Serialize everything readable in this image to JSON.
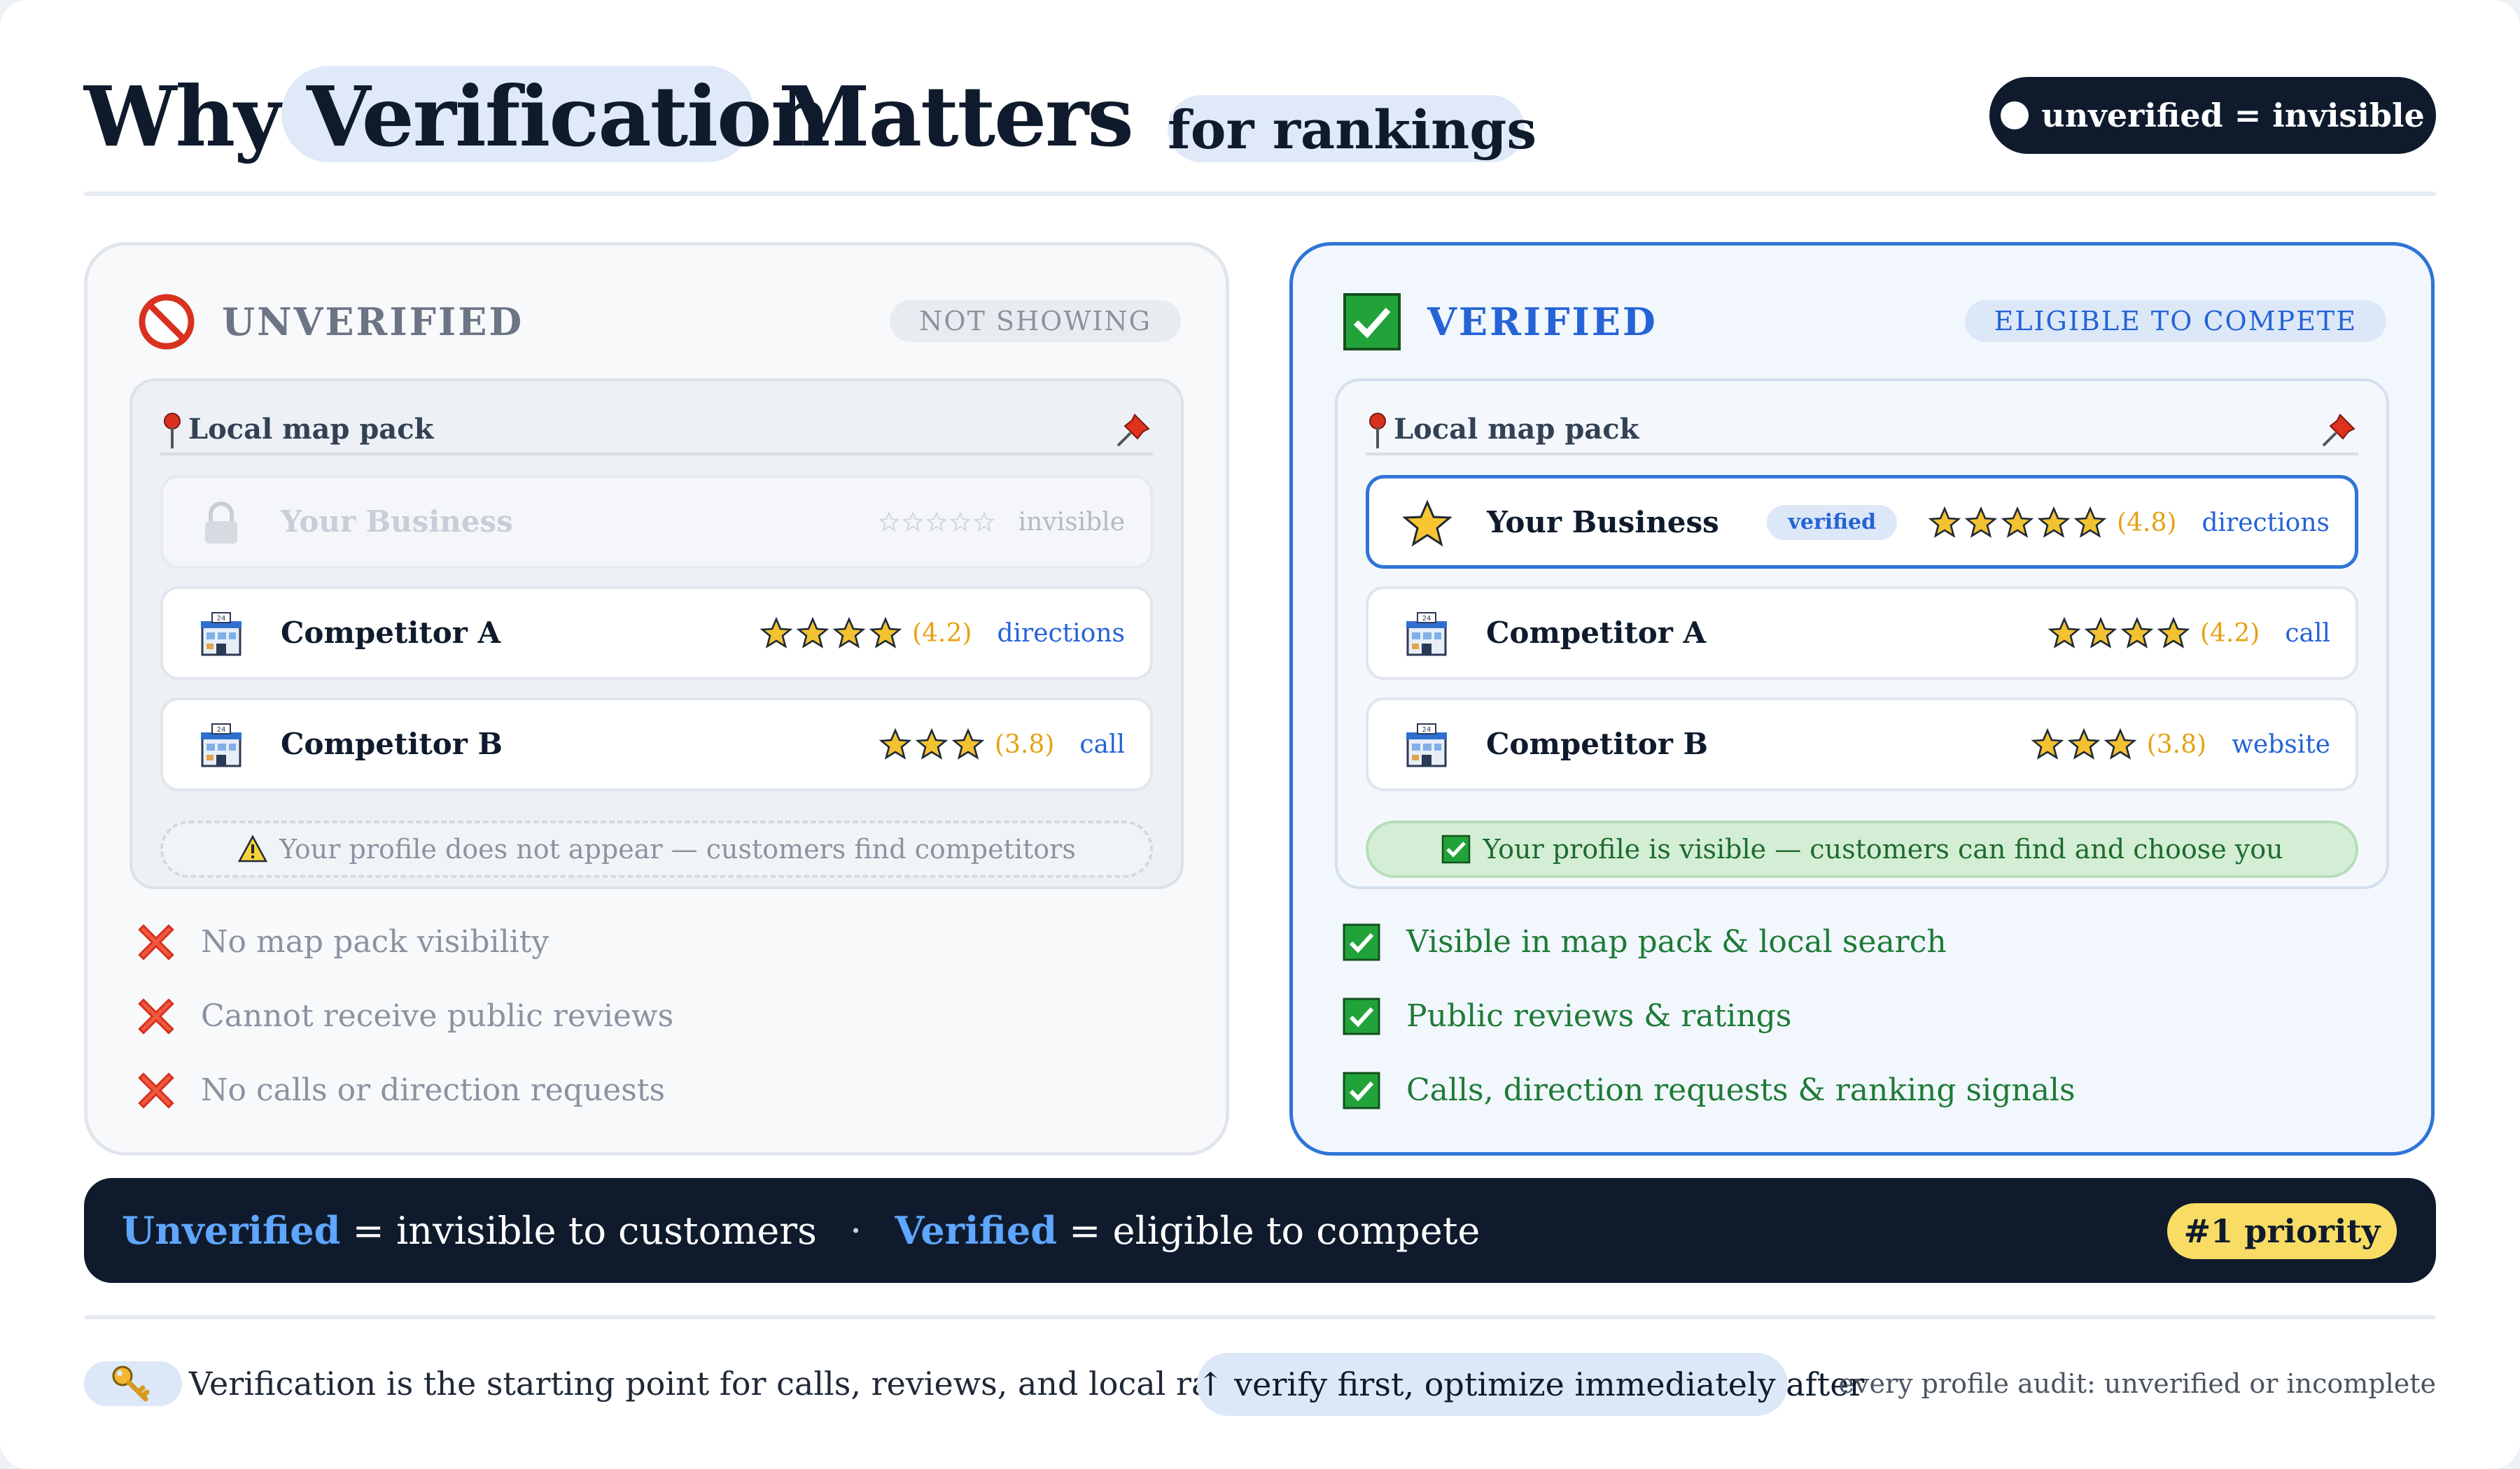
{
  "header": {
    "title_why": "Why",
    "title_verification": "Verification",
    "title_matters": "Matters",
    "subtitle": "for rankings",
    "badge_label": "unverified = invisible"
  },
  "unverified": {
    "title": "UNVERIFIED",
    "tag": "NOT SHOWING",
    "icon": "no-entry-icon",
    "pack_label": "Local map pack",
    "rows": [
      {
        "name": "Your Business",
        "icon": "lock-icon",
        "rating": null,
        "stars": 5,
        "action": "invisible"
      },
      {
        "name": "Competitor A",
        "icon": "store-icon",
        "rating": "(4.2)",
        "stars": 4,
        "action": "directions"
      },
      {
        "name": "Competitor B",
        "icon": "store-icon",
        "rating": "(3.8)",
        "stars": 3,
        "action": "call"
      }
    ],
    "note": "Your profile does not appear — customers find competitors",
    "bullets": [
      "No map pack visibility",
      "Cannot receive public reviews",
      "No calls or direction requests"
    ]
  },
  "verified": {
    "title": "VERIFIED",
    "tag": "ELIGIBLE TO COMPETE",
    "icon": "check-box-icon",
    "pack_label": "Local map pack",
    "rows": [
      {
        "name": "Your Business",
        "icon": "star-icon",
        "badge": "verified",
        "rating": "(4.8)",
        "stars": 5,
        "action": "directions"
      },
      {
        "name": "Competitor A",
        "icon": "store-icon",
        "rating": "(4.2)",
        "stars": 4,
        "action": "call"
      },
      {
        "name": "Competitor B",
        "icon": "store-icon",
        "rating": "(3.8)",
        "stars": 3,
        "action": "website"
      }
    ],
    "note": "Your profile is visible — customers can find and choose you",
    "bullets": [
      "Visible in map pack & local search",
      "Public reviews & ratings",
      "Calls, direction requests & ranking signals"
    ]
  },
  "summary": {
    "unverified_kw": "Unverified",
    "unverified_text": "= invisible to customers",
    "separator": "·",
    "verified_kw": "Verified",
    "verified_text": "= eligible to compete",
    "priority": "#1 priority"
  },
  "footer": {
    "key_text": "Verification is the starting point for calls, reviews, and local rankings",
    "pill_text": "↑ verify first, optimize immediately after",
    "note": "every profile audit: unverified or incomplete"
  },
  "colors": {
    "navy": "#0f1b2d",
    "accent_blue": "#2563d6",
    "verified_green": "#1e7a36",
    "star_gold": "#f2c230",
    "priority_yellow": "#f8dc64"
  }
}
